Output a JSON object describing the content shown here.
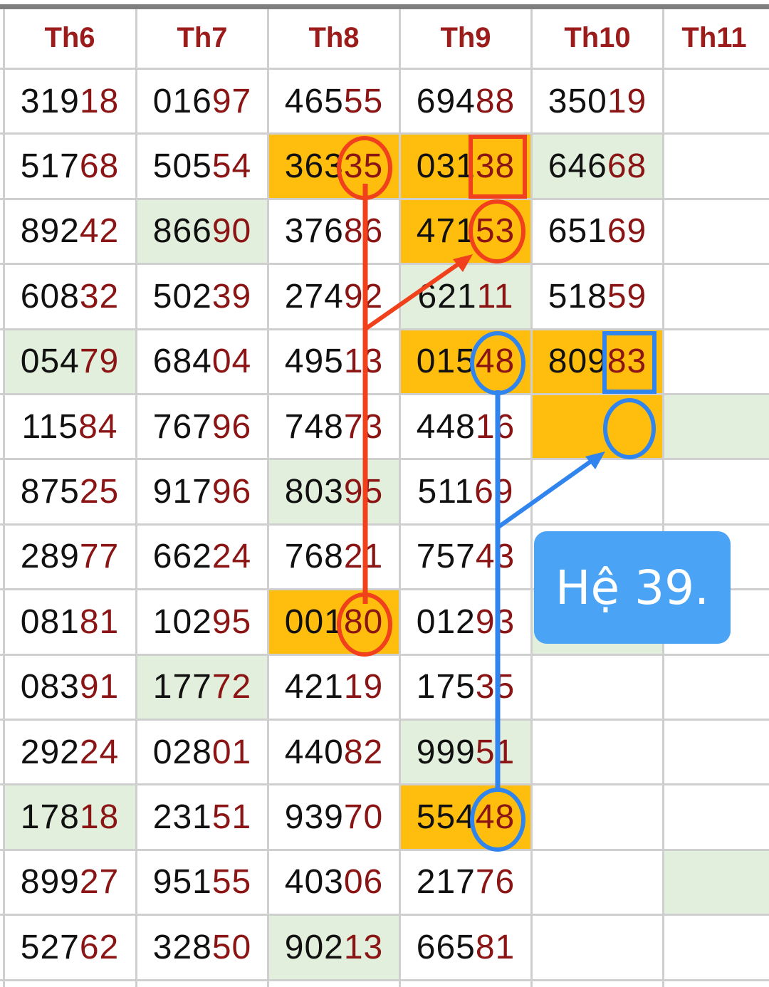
{
  "headers": [
    "Th6",
    "Th7",
    "Th8",
    "Th9",
    "Th10",
    "Th11"
  ],
  "rows": [
    [
      "31918",
      "01697",
      "46555",
      "69488",
      "35019",
      ""
    ],
    [
      "51768",
      "50554",
      "36335",
      "03138",
      "64668",
      ""
    ],
    [
      "89242",
      "86690",
      "37686",
      "47153",
      "65169",
      ""
    ],
    [
      "60832",
      "50239",
      "27492",
      "62111",
      "51859",
      ""
    ],
    [
      "05479",
      "68404",
      "49513",
      "01548",
      "80983",
      ""
    ],
    [
      "11584",
      "76796",
      "74873",
      "44816",
      "",
      ""
    ],
    [
      "87525",
      "91796",
      "80395",
      "51169",
      "",
      ""
    ],
    [
      "28977",
      "66224",
      "76821",
      "75743",
      "",
      ""
    ],
    [
      "08181",
      "10295",
      "00180",
      "01293",
      "",
      ""
    ],
    [
      "08391",
      "17772",
      "42119",
      "17535",
      "",
      ""
    ],
    [
      "29224",
      "02801",
      "44082",
      "99951",
      "",
      ""
    ],
    [
      "17818",
      "23151",
      "93970",
      "55448",
      "",
      ""
    ],
    [
      "89927",
      "95155",
      "40306",
      "21776",
      "",
      ""
    ],
    [
      "52762",
      "32850",
      "90213",
      "66581",
      "",
      ""
    ]
  ],
  "note": {
    "text": "Hệ 39."
  },
  "colors": {
    "header_text": "#9c1c1c",
    "tail_digits": "#8b1414",
    "highlight_gold": "#ffbe0d",
    "highlight_green": "#e1efdc",
    "red_marker": "#f0401c",
    "blue_marker": "#2f84ee",
    "note_background": "#4aa3f5"
  }
}
